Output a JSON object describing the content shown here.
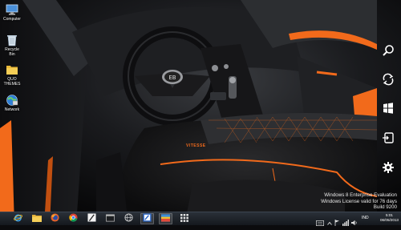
{
  "desktop": {
    "icons": [
      {
        "label": "Computer",
        "icon": "computer-icon"
      },
      {
        "label": "Recycle Bin",
        "icon": "recycle-bin-icon"
      },
      {
        "label": "QUO THEMES",
        "icon": "folder-icon"
      },
      {
        "label": "Network",
        "icon": "network-icon"
      }
    ],
    "wallpaper_badge": "VITESSE"
  },
  "charms": [
    {
      "name": "search",
      "icon": "search-icon"
    },
    {
      "name": "share",
      "icon": "share-icon"
    },
    {
      "name": "start",
      "icon": "windows-logo-icon"
    },
    {
      "name": "devices",
      "icon": "devices-icon"
    },
    {
      "name": "settings",
      "icon": "gear-icon"
    }
  ],
  "watermark": {
    "line1": "Windows 8 Enterprise Evaluation",
    "line2": "Windows License valid for 76 days",
    "line3": "Build 9200"
  },
  "taskbar": {
    "pinned": [
      {
        "name": "internet-explorer",
        "icon": "internet-explorer-icon"
      },
      {
        "name": "file-explorer",
        "icon": "folder-icon"
      },
      {
        "name": "firefox",
        "icon": "firefox-icon"
      },
      {
        "name": "chrome",
        "icon": "chrome-icon"
      },
      {
        "name": "tool",
        "icon": "pen-tool-icon"
      },
      {
        "name": "window",
        "icon": "window-icon"
      },
      {
        "name": "globe",
        "icon": "globe-icon"
      },
      {
        "name": "paint",
        "icon": "paint-icon"
      },
      {
        "name": "image-viewer",
        "icon": "image-viewer-icon"
      },
      {
        "name": "apps-grid",
        "icon": "grid-icon"
      }
    ],
    "tray": {
      "language": "IND",
      "time": "5:01",
      "date": "06/05/2013"
    }
  },
  "colors": {
    "accent_orange": "#f26a1b",
    "taskbar": "#1c2228",
    "interior": "#121214"
  }
}
